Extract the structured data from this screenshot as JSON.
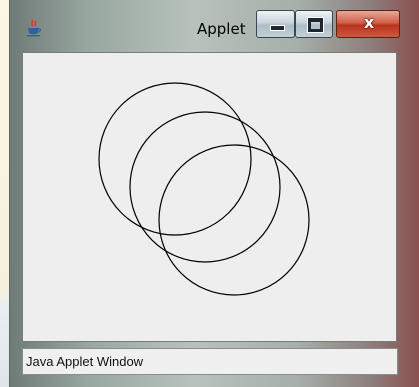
{
  "window": {
    "title": "Applet",
    "app_icon": "java-cup-icon",
    "controls": {
      "minimize_icon": "minimize-icon",
      "maximize_icon": "maximize-icon",
      "close_label": "x"
    }
  },
  "canvas": {
    "shapes": [
      {
        "type": "circle",
        "stroke": "#000000"
      },
      {
        "type": "circle",
        "stroke": "#000000"
      },
      {
        "type": "circle",
        "stroke": "#000000"
      }
    ]
  },
  "status_bar": {
    "text": "Java Applet Window"
  }
}
